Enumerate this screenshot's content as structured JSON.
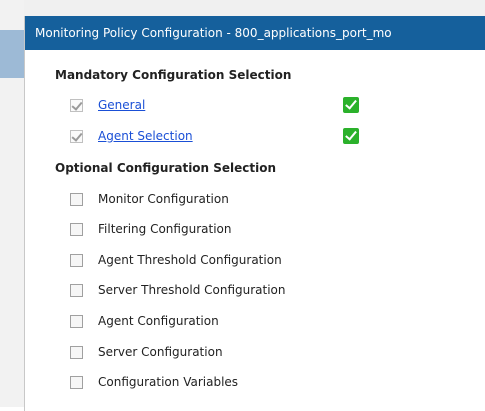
{
  "dialog": {
    "title": "Monitoring Policy Configuration - 800_applications_port_mo"
  },
  "mandatory": {
    "heading": "Mandatory Configuration Selection",
    "items": [
      {
        "label": "General",
        "checked": true,
        "status": "complete"
      },
      {
        "label": "Agent Selection",
        "checked": true,
        "status": "complete"
      }
    ]
  },
  "optional": {
    "heading": "Optional Configuration Selection",
    "items": [
      {
        "label": "Monitor Configuration",
        "checked": false
      },
      {
        "label": "Filtering Configuration",
        "checked": false
      },
      {
        "label": "Agent Threshold Configuration",
        "checked": false
      },
      {
        "label": "Server Threshold Configuration",
        "checked": false
      },
      {
        "label": "Agent Configuration",
        "checked": false
      },
      {
        "label": "Server Configuration",
        "checked": false
      },
      {
        "label": "Configuration Variables",
        "checked": false
      }
    ]
  },
  "colors": {
    "titlebar": "#15609c",
    "status_ok": "#2bb12b",
    "link": "#1a4fd6"
  }
}
